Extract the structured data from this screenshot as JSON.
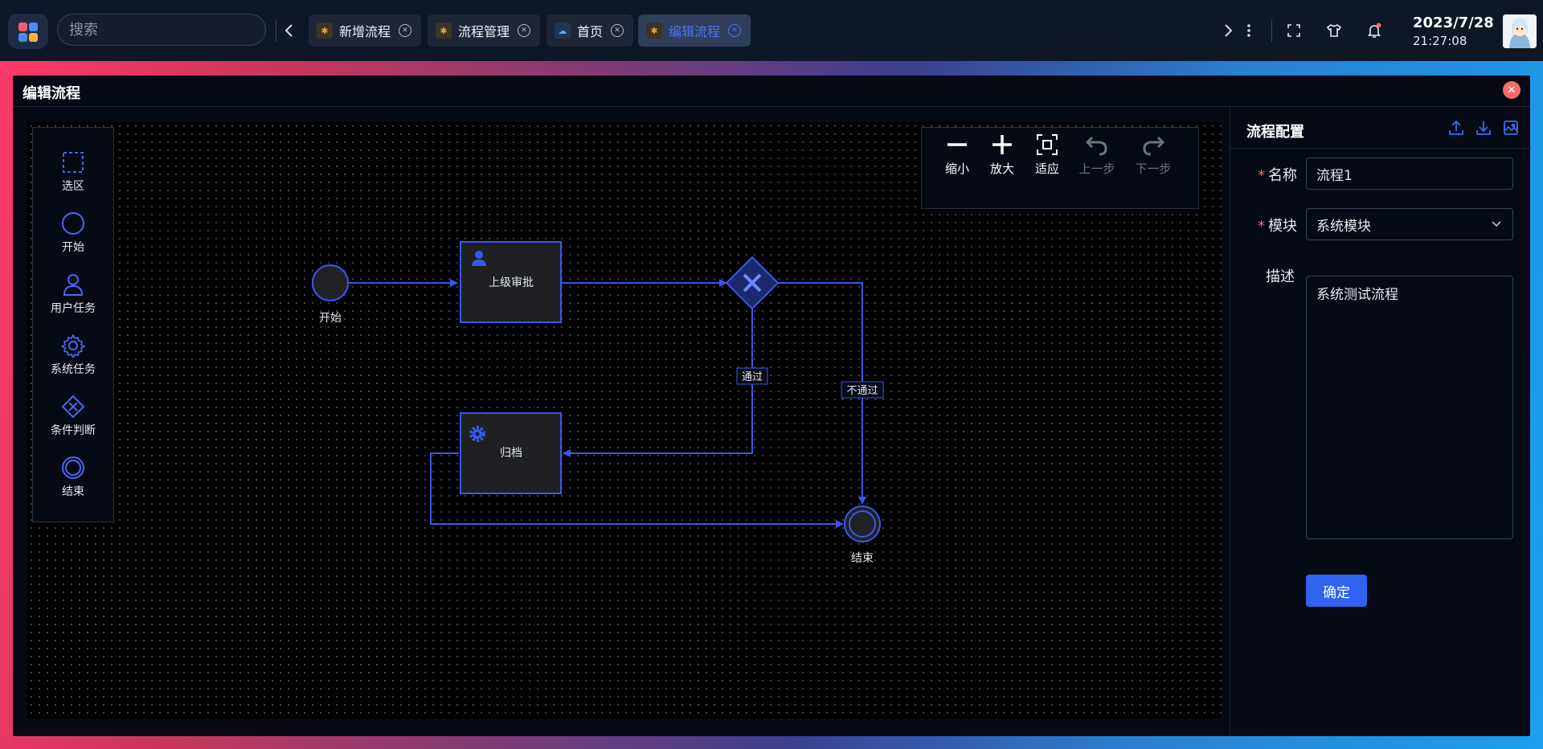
{
  "search": {
    "placeholder": "搜索"
  },
  "tabs": [
    {
      "label": "新增流程",
      "active": false
    },
    {
      "label": "流程管理",
      "active": false
    },
    {
      "label": "首页",
      "active": false
    },
    {
      "label": "编辑流程",
      "active": true
    }
  ],
  "clock": {
    "date": "2023/7/28",
    "time": "21:27:08"
  },
  "panel": {
    "title": "编辑流程"
  },
  "palette": [
    {
      "label": "选区",
      "icon": "selection-icon"
    },
    {
      "label": "开始",
      "icon": "start-event-icon"
    },
    {
      "label": "用户任务",
      "icon": "user-task-icon"
    },
    {
      "label": "系统任务",
      "icon": "gear-icon"
    },
    {
      "label": "条件判断",
      "icon": "gateway-icon"
    },
    {
      "label": "结束",
      "icon": "end-event-icon"
    }
  ],
  "toolbar": {
    "zoom_out": "缩小",
    "zoom_in": "放大",
    "fit": "适应",
    "undo": "上一步",
    "redo": "下一步"
  },
  "diagram": {
    "start_label": "开始",
    "approve_label": "上级审批",
    "archive_label": "归档",
    "end_label": "结束",
    "pass_label": "通过",
    "reject_label": "不通过"
  },
  "config": {
    "title": "流程配置",
    "name_label": "名称",
    "name_value": "流程1",
    "module_label": "模块",
    "module_value": "系统模块",
    "desc_label": "描述",
    "desc_value": "系统测试流程",
    "confirm_label": "确定"
  },
  "colors": {
    "accent": "#2f63f0",
    "node_stroke": "#3b57e8",
    "danger": "#f56c6c",
    "topbar": "#0e1726"
  }
}
